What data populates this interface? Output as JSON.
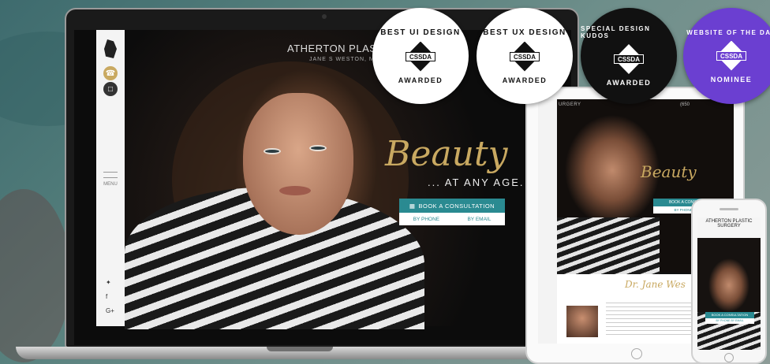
{
  "laptop": {
    "site_title": "ATHERTON PLASTIC SU",
    "site_subtitle": "JANE S WESTON, MD FA",
    "tagline_script": "Beauty",
    "tagline_sub": "... AT ANY AGE.",
    "cta_label": "BOOK A CONSULTATION",
    "cta_phone": "BY PHONE",
    "cta_email": "BY EMAIL",
    "menu_label": "MENU",
    "phone_icon": "phone-icon",
    "chat_icon": "chat-icon",
    "social": [
      "twitter-icon",
      "facebook-icon",
      "google-plus-icon"
    ]
  },
  "badges": [
    {
      "top": "BEST UI DESIGN",
      "mark": "CSSDA",
      "bottom": "AWARDED",
      "bg": "#ffffff",
      "fg": "#111111"
    },
    {
      "top": "BEST UX DESIGN",
      "mark": "CSSDA",
      "bottom": "AWARDED",
      "bg": "#ffffff",
      "fg": "#111111"
    },
    {
      "top": "SPECIAL DESIGN KUDOS",
      "mark": "CSSDA",
      "bottom": "AWARDED",
      "bg": "#111111",
      "fg": "#ffffff"
    },
    {
      "top": "WEBSITE OF THE DAY",
      "mark": "CSSDA",
      "bottom": "NOMINEE",
      "bg": "#6b3fd1",
      "fg": "#ffffff"
    }
  ],
  "tablet": {
    "topbar_left": "URGERY",
    "topbar_right": "(650",
    "tagline_script": "Beauty",
    "cta_label": "BOOK A CONSULTATION",
    "cta_sub": "BY PHONE   BY EMAIL",
    "doctor_script": "Dr. Jane Wes"
  },
  "phone": {
    "site_title": "ATHERTON PLASTIC SURGERY",
    "cta_label": "BOOK A CONSULTATION",
    "cta_sub": "BY PHONE   BY EMAIL"
  },
  "colors": {
    "accent": "#2a8a91",
    "gold": "#c9a961"
  }
}
